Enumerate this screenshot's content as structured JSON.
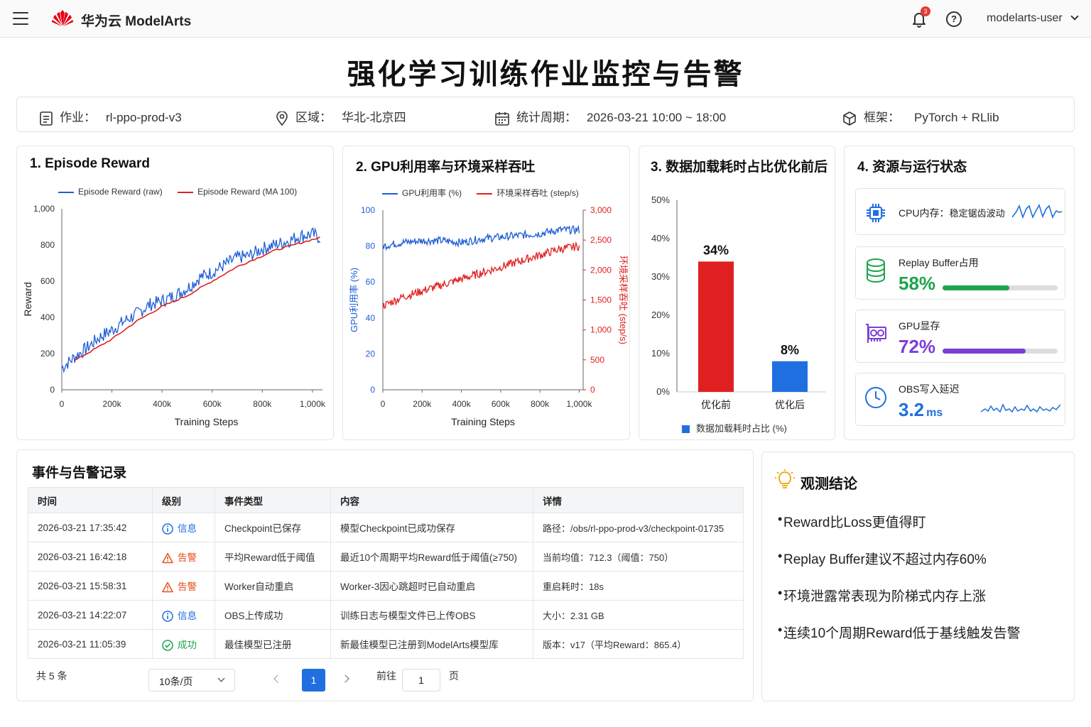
{
  "header": {
    "brand": "华为云 ModelArts",
    "notif_count": "3",
    "help": "?",
    "user": "modelarts-user"
  },
  "page_title": "强化学习训练作业监控与告警",
  "job_info": {
    "job_label": "作业：",
    "job_value": "rl-ppo-prod-v3",
    "region_label": "区域：",
    "region_value": "华北-北京四",
    "period_label": "统计周期：",
    "period_value": "2026-03-21 10:00 ~ 18:00",
    "framework_label": "框架：",
    "framework_value": "PyTorch + RLlib"
  },
  "chart1": {
    "title": "1. Episode Reward",
    "legend_raw": "Episode Reward (raw)",
    "legend_ma": "Episode Reward (MA 100)",
    "xlabel": "Training Steps",
    "ylabel": "Reward"
  },
  "chart2": {
    "title": "2. GPU利用率与环境采样吞吐",
    "legend_gpu": "GPU利用率 (%)",
    "legend_env": "环境采样吞吐 (step/s)",
    "xlabel": "Training Steps",
    "ylabel_left": "GPU利用率 (%)",
    "ylabel_right": "环境采样吞吐 (step/s)"
  },
  "chart3": {
    "title": "3. 数据加载耗时占比优化前后",
    "legend": "数据加载耗时占比 (%)"
  },
  "chart_data": [
    {
      "type": "line",
      "title": "1. Episode Reward",
      "xlabel": "Training Steps",
      "ylabel": "Reward",
      "xlim": [
        0,
        1040000
      ],
      "ylim": [
        0,
        1000
      ],
      "x_ticks": [
        "0",
        "200k",
        "400k",
        "600k",
        "800k",
        "1,000k"
      ],
      "y_ticks": [
        "0",
        "200",
        "400",
        "600",
        "800",
        "1,000"
      ],
      "legend_position": "top",
      "series": [
        {
          "name": "Episode Reward (raw)",
          "color": "#1f5fd6",
          "x": [
            0,
            50000,
            100000,
            150000,
            200000,
            250000,
            300000,
            350000,
            400000,
            450000,
            500000,
            550000,
            600000,
            650000,
            700000,
            750000,
            800000,
            850000,
            900000,
            950000,
            1000000,
            1030000
          ],
          "y": [
            120,
            180,
            230,
            290,
            330,
            380,
            420,
            470,
            490,
            520,
            560,
            620,
            650,
            690,
            730,
            740,
            780,
            800,
            820,
            850,
            860,
            840
          ]
        },
        {
          "name": "Episode Reward (MA 100)",
          "color": "#e02020",
          "x": [
            50000,
            100000,
            150000,
            200000,
            250000,
            300000,
            350000,
            400000,
            450000,
            500000,
            550000,
            600000,
            650000,
            700000,
            750000,
            800000,
            850000,
            900000,
            950000,
            1000000,
            1030000
          ],
          "y": [
            160,
            200,
            240,
            280,
            330,
            380,
            420,
            460,
            490,
            520,
            560,
            600,
            640,
            680,
            710,
            740,
            770,
            790,
            810,
            830,
            840
          ]
        }
      ]
    },
    {
      "type": "line",
      "title": "2. GPU利用率与环境采样吞吐",
      "xlabel": "Training Steps",
      "xlim": [
        0,
        1020000
      ],
      "x_ticks": [
        "0",
        "200k",
        "400k",
        "600k",
        "800k",
        "1,000k"
      ],
      "y_left_ticks": [
        "0",
        "20",
        "40",
        "60",
        "80",
        "100"
      ],
      "y_right_ticks": [
        "0",
        "500",
        "1,000",
        "1,500",
        "2,000",
        "2,500",
        "3,000"
      ],
      "ylim_left": [
        0,
        100
      ],
      "ylim_right": [
        0,
        3000
      ],
      "legend_position": "top",
      "series": [
        {
          "name": "GPU利用率 (%)",
          "axis": "left",
          "color": "#1f5fd6",
          "x": [
            0,
            100000,
            200000,
            300000,
            400000,
            500000,
            600000,
            700000,
            800000,
            900000,
            1000000
          ],
          "y": [
            80,
            82,
            83,
            83,
            82,
            84,
            85,
            86,
            87,
            89,
            89
          ]
        },
        {
          "name": "环境采样吞吐 (step/s)",
          "axis": "right",
          "color": "#e02020",
          "x": [
            0,
            100000,
            200000,
            300000,
            400000,
            500000,
            600000,
            700000,
            800000,
            900000,
            1000000
          ],
          "y": [
            1400,
            1550,
            1650,
            1750,
            1850,
            1950,
            2050,
            2150,
            2250,
            2350,
            2400
          ]
        }
      ]
    },
    {
      "type": "bar",
      "title": "3. 数据加载耗时占比优化前后",
      "categories": [
        "优化前",
        "优化后"
      ],
      "values": [
        34,
        8
      ],
      "value_labels": [
        "34%",
        "8%"
      ],
      "colors": [
        "#e02020",
        "#1f6fe0"
      ],
      "ylim": [
        0,
        50
      ],
      "y_ticks": [
        "0%",
        "10%",
        "20%",
        "30%",
        "40%",
        "50%"
      ],
      "legend": "数据加载耗时占比 (%)",
      "legend_position": "bottom"
    }
  ],
  "resources": {
    "title": "4. 资源与运行状态",
    "cpu_label": "CPU内存：",
    "cpu_note": "稳定锯齿波动",
    "replay_label": "Replay Buffer占用",
    "replay_pct": "58%",
    "replay_value": 0.58,
    "gpu_label": "GPU显存",
    "gpu_pct": "72%",
    "gpu_value": 0.72,
    "obs_label": "OBS写入延迟",
    "obs_value": "3.2",
    "obs_unit": "ms",
    "colors": {
      "replay": "#1ea44c",
      "gpu": "#7a3fd6",
      "obs": "#1f6fe0"
    }
  },
  "events": {
    "title": "事件与告警记录",
    "columns": [
      "时间",
      "级别",
      "事件类型",
      "内容",
      "详情"
    ],
    "rows": [
      {
        "time": "2026-03-21 17:35:42",
        "level": "信息",
        "level_kind": "info",
        "type": "Checkpoint已保存",
        "content": "模型Checkpoint已成功保存",
        "detail": "路径：/obs/rl-ppo-prod-v3/checkpoint-01735"
      },
      {
        "time": "2026-03-21 16:42:18",
        "level": "告警",
        "level_kind": "warn",
        "type": "平均Reward低于阈值",
        "content": "最近10个周期平均Reward低于阈值(≥750)",
        "detail": "当前均值：712.3（阈值：750）"
      },
      {
        "time": "2026-03-21 15:58:31",
        "level": "告警",
        "level_kind": "warn",
        "type": "Worker自动重启",
        "content": "Worker-3因心跳超时已自动重启",
        "detail": "重启耗时：18s"
      },
      {
        "time": "2026-03-21 14:22:07",
        "level": "信息",
        "level_kind": "info",
        "type": "OBS上传成功",
        "content": "训练日志与模型文件已上传OBS",
        "detail": "大小：2.31 GB"
      },
      {
        "time": "2026-03-21 11:05:39",
        "level": "成功",
        "level_kind": "ok",
        "type": "最佳模型已注册",
        "content": "新最佳模型已注册到ModelArts模型库",
        "detail": "版本：v17（平均Reward：865.4）"
      }
    ],
    "level_colors": {
      "info": "#1f6fe0",
      "warn": "#e8501e",
      "ok": "#1ea44c"
    },
    "total": "共 5 条",
    "page_size": "10条/页",
    "current_page": "1",
    "goto_label": "前往",
    "goto_value": "1",
    "page_suffix": "页"
  },
  "conclusions": {
    "title": "观测结论",
    "items": [
      "Reward比Loss更值得盯",
      "Replay Buffer建议不超过内存60%",
      "环境泄露常表现为阶梯式内存上涨",
      "连续10个周期Reward低于基线触发告警"
    ]
  }
}
